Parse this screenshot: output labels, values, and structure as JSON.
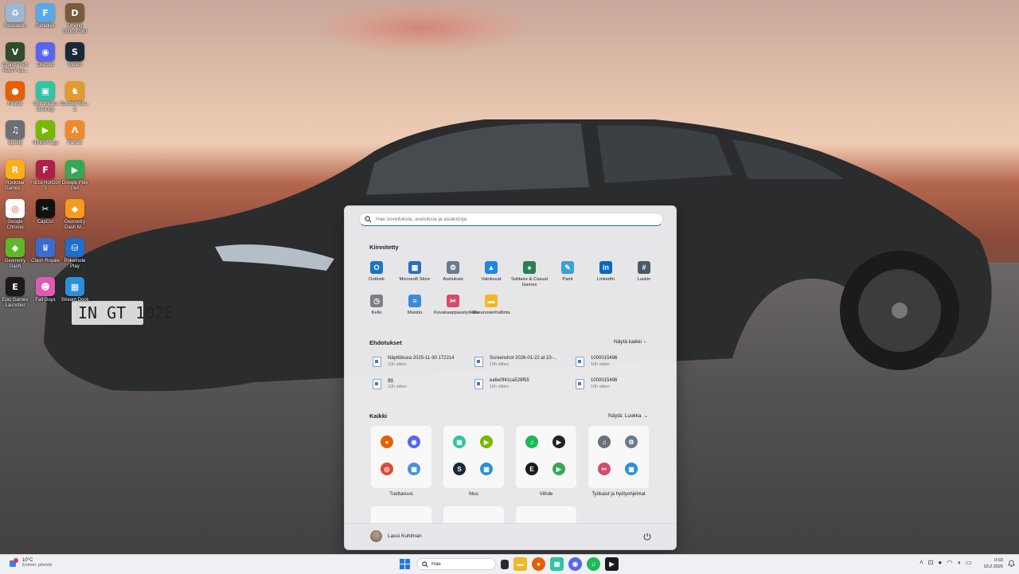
{
  "desktop": {
    "icons": [
      {
        "label": "Roskakori",
        "bg": "#9bb7d6",
        "glyph": "♻"
      },
      {
        "label": "Paradise",
        "bg": "#5aa9e6",
        "glyph": "F"
      },
      {
        "label": "Driving School Sim",
        "bg": "#7a5a3c",
        "glyph": "D"
      },
      {
        "label": "Grand Theft Auto V La...",
        "bg": "#2f4d2a",
        "glyph": "V"
      },
      {
        "label": "Discord",
        "bg": "#5865f2",
        "glyph": "◉"
      },
      {
        "label": "Steam",
        "bg": "#1b2838",
        "glyph": "S"
      },
      {
        "label": "Firefox",
        "bg": "#e66000",
        "glyph": "●"
      },
      {
        "label": "Streamlabs Desktop",
        "bg": "#31c3a2",
        "glyph": "▣"
      },
      {
        "label": "Counter-Stri... 2",
        "bg": "#e39b2d",
        "glyph": "♞"
      },
      {
        "label": "Spotify",
        "bg": "#6a6f78",
        "glyph": "♫"
      },
      {
        "label": "NVIDIA App",
        "bg": "#76b900",
        "glyph": "▶"
      },
      {
        "label": "Parsec",
        "bg": "#f08a2a",
        "glyph": "Λ"
      },
      {
        "label": "Rockstar Games ...",
        "bg": "#fcaf17",
        "glyph": "R"
      },
      {
        "label": "Forza Horizon 5",
        "bg": "#b01f4a",
        "glyph": "F"
      },
      {
        "label": "Google Play Peli",
        "bg": "#34a853",
        "glyph": "▶"
      },
      {
        "label": "Google Chrome",
        "bg": "#ffffff",
        "glyph": "◎"
      },
      {
        "label": "CapCut",
        "bg": "#111111",
        "glyph": "✂"
      },
      {
        "label": "Geometry Dash M...",
        "bg": "#f59b1c",
        "glyph": "◆"
      },
      {
        "label": "Geometry Dash",
        "bg": "#5fb82b",
        "glyph": "◆"
      },
      {
        "label": "Clash Royale",
        "bg": "#3a6bd1",
        "glyph": "♛"
      },
      {
        "label": "Pokemote Play",
        "bg": "#1d6fc9",
        "glyph": "⛁"
      },
      {
        "label": "Epic Games Launcher",
        "bg": "#1a1a1a",
        "glyph": "E"
      },
      {
        "label": "Fall Guys",
        "bg": "#e05ab4",
        "glyph": "☻"
      },
      {
        "label": "Stream Dock",
        "bg": "#2a8fd8",
        "glyph": "▦"
      }
    ]
  },
  "start_menu": {
    "search_placeholder": "Hae sovelluksia, asetuksia ja asiakirjoja",
    "pinned_title": "Kiinnitetty",
    "pinned": [
      {
        "label": "Outlook",
        "bg": "#1a73c8",
        "glyph": "O"
      },
      {
        "label": "Microsoft Store",
        "bg": "#2b6cc4",
        "glyph": "▦"
      },
      {
        "label": "Asetukset",
        "bg": "#6b7a8c",
        "glyph": "⚙"
      },
      {
        "label": "Valokuvat",
        "bg": "#1e88e5",
        "glyph": "▲"
      },
      {
        "label": "Solitaire & Casual Games",
        "bg": "#2e7d57",
        "glyph": "♠"
      },
      {
        "label": "Paint",
        "bg": "#3aa0d8",
        "glyph": "✎"
      },
      {
        "label": "LinkedIn",
        "bg": "#0a66c2",
        "glyph": "in"
      },
      {
        "label": "Laskin",
        "bg": "#4a5a6a",
        "glyph": "#"
      },
      {
        "label": "Kello",
        "bg": "#7a7f88",
        "glyph": "◷"
      },
      {
        "label": "Muistio",
        "bg": "#3b8ad8",
        "glyph": "≡"
      },
      {
        "label": "Kuvakaappaustyökalu",
        "bg": "#d64a6a",
        "glyph": "✂"
      },
      {
        "label": "Resurssienhallinta",
        "bg": "#f2b824",
        "glyph": "▬"
      }
    ],
    "suggestions_title": "Ehdotukset",
    "suggestions_more": "Näytä kaikki",
    "suggestions": [
      {
        "name": "Näyttökuva 2025-11-30 172214",
        "time": "10h sitten"
      },
      {
        "name": "Screenshot 2026-01-22 at 23-...",
        "time": "10h sitten"
      },
      {
        "name": "1000015496",
        "time": "10h sitten"
      },
      {
        "name": "gg",
        "time": "10h sitten"
      },
      {
        "name": "ea6e0f41ca528f55",
        "time": "10h sitten"
      },
      {
        "name": "1000015496",
        "time": "10h sitten"
      }
    ],
    "all_title": "Kaikki",
    "all_view": "Näytä: Luokka",
    "groups": [
      {
        "label": "Tuottavuus",
        "icons": [
          {
            "bg": "#e66000",
            "glyph": "●"
          },
          {
            "bg": "#5865f2",
            "glyph": "◉"
          },
          {
            "bg": "#dd4b39",
            "glyph": "◎"
          },
          {
            "bg": "#4a90d9",
            "glyph": "▦"
          }
        ]
      },
      {
        "label": "Muu",
        "icons": [
          {
            "bg": "#31c3a2",
            "glyph": "▣"
          },
          {
            "bg": "#76b900",
            "glyph": "▶"
          },
          {
            "bg": "#1b2838",
            "glyph": "S"
          },
          {
            "bg": "#2a8fd8",
            "glyph": "▦"
          }
        ]
      },
      {
        "label": "Viihde",
        "icons": [
          {
            "bg": "#1db954",
            "glyph": "♫"
          },
          {
            "bg": "#222222",
            "glyph": "▶"
          },
          {
            "bg": "#1a1a1a",
            "glyph": "E"
          },
          {
            "bg": "#34a853",
            "glyph": "▶"
          }
        ]
      },
      {
        "label": "Työkalut ja hyötyohjelmat",
        "icons": [
          {
            "bg": "#6a6f78",
            "glyph": "♫"
          },
          {
            "bg": "#6b7a8c",
            "glyph": "⚙"
          },
          {
            "bg": "#d64a6a",
            "glyph": "✂"
          },
          {
            "bg": "#2a8fd8",
            "glyph": "▦"
          }
        ]
      }
    ],
    "user": "Lassi Kuhlman"
  },
  "taskbar": {
    "weather_temp": "10°C",
    "weather_desc": "Enimm. pilvistä",
    "search_label": "Hae",
    "time": "0:03",
    "date": "10.2.2026",
    "tray_icons": [
      "chevron-up-icon",
      "network-icon",
      "mic-icon",
      "wifi-icon",
      "volume-icon",
      "battery-icon"
    ]
  }
}
